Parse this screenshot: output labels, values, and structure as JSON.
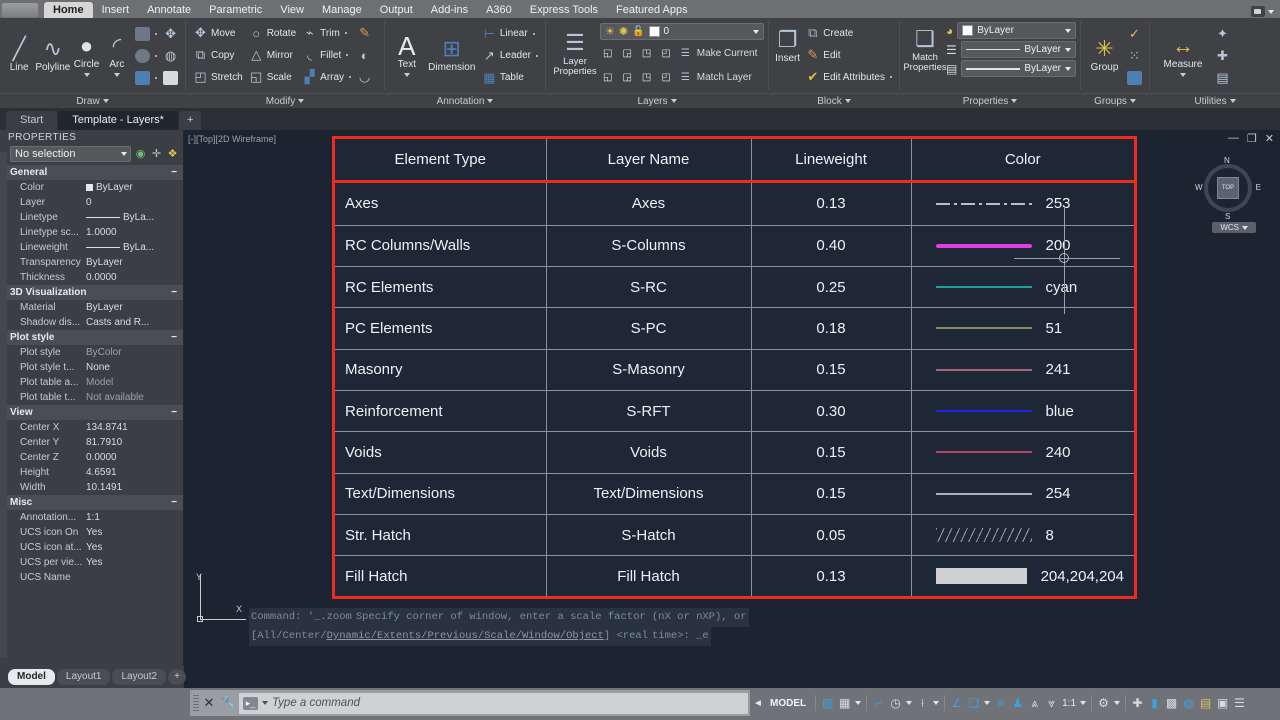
{
  "menubar": {
    "tabs": [
      {
        "label": "Home",
        "active": true
      },
      {
        "label": "Insert",
        "active": false
      },
      {
        "label": "Annotate",
        "active": false
      },
      {
        "label": "Parametric",
        "active": false
      },
      {
        "label": "View",
        "active": false
      },
      {
        "label": "Manage",
        "active": false
      },
      {
        "label": "Output",
        "active": false
      },
      {
        "label": "Add-ins",
        "active": false
      },
      {
        "label": "A360",
        "active": false
      },
      {
        "label": "Express Tools",
        "active": false
      },
      {
        "label": "Featured Apps",
        "active": false
      }
    ]
  },
  "ribbon": {
    "panels": [
      {
        "title": "Draw",
        "big": [
          {
            "label": "Line",
            "icon": "line-icon",
            "glyph": "╱"
          },
          {
            "label": "Polyline",
            "icon": "polyline-icon",
            "glyph": "∿"
          },
          {
            "label": "Circle",
            "icon": "circle-icon",
            "glyph": "●",
            "has_caret": true
          },
          {
            "label": "Arc",
            "icon": "arc-icon",
            "glyph": "◜",
            "has_caret": true
          }
        ],
        "small": [
          {
            "label": "",
            "icon": "rectangle-icon",
            "glyph": "▭"
          },
          {
            "label": "",
            "icon": "ellipse-icon",
            "glyph": "⬭"
          },
          {
            "label": "",
            "icon": "hatch-icon",
            "glyph": "░"
          }
        ]
      },
      {
        "title": "Modify",
        "rows": [
          [
            {
              "label": "Move",
              "icon": "move-icon",
              "glyph": "✥"
            },
            {
              "label": "Rotate",
              "icon": "rotate-icon",
              "glyph": "⟳"
            },
            {
              "label": "Trim",
              "icon": "trim-icon",
              "glyph": "✂"
            }
          ],
          [
            {
              "label": "Copy",
              "icon": "copy-icon",
              "glyph": "⧉"
            },
            {
              "label": "Mirror",
              "icon": "mirror-icon",
              "glyph": "△"
            },
            {
              "label": "Fillet",
              "icon": "fillet-icon",
              "glyph": "◟"
            }
          ],
          [
            {
              "label": "Stretch",
              "icon": "stretch-icon",
              "glyph": "◰"
            },
            {
              "label": "Scale",
              "icon": "scale-icon",
              "glyph": "◱"
            },
            {
              "label": "Array",
              "icon": "array-icon",
              "glyph": "⊞"
            }
          ]
        ]
      },
      {
        "title": "Annotation",
        "big": [
          {
            "label": "Text",
            "icon": "text-icon",
            "glyph": "A",
            "has_caret": true
          },
          {
            "label": "Dimension",
            "icon": "dimension-icon",
            "glyph": "↦"
          }
        ],
        "small": [
          {
            "label": "Linear",
            "icon": "linear-dimension-icon",
            "glyph": "⊢"
          },
          {
            "label": "Leader",
            "icon": "leader-icon",
            "glyph": "↗"
          },
          {
            "label": "Table",
            "icon": "table-icon",
            "glyph": "⊞"
          }
        ]
      },
      {
        "title": "Layers",
        "big": [
          {
            "label": "Layer\nProperties",
            "icon": "layer-properties-icon",
            "glyph": "☲"
          }
        ],
        "layer_combo": {
          "value": "0",
          "icons": [
            "lightbulb-icon",
            "sun-icon",
            "unlock-icon"
          ],
          "swatch": "#ffffff"
        },
        "small": [
          {
            "label": "Make Current",
            "icon": "make-current-icon",
            "glyph": "☲"
          },
          {
            "label": "Match Layer",
            "icon": "match-layer-icon",
            "glyph": "☲"
          }
        ]
      },
      {
        "title": "Block",
        "big": [
          {
            "label": "Insert",
            "icon": "insert-block-icon",
            "glyph": "❐"
          }
        ],
        "small": [
          {
            "label": "Create",
            "icon": "create-block-icon",
            "glyph": "⧉"
          },
          {
            "label": "Edit",
            "icon": "edit-block-icon",
            "glyph": "✎"
          },
          {
            "label": "Edit Attributes",
            "icon": "edit-attributes-icon",
            "glyph": "✔",
            "has_caret": true
          }
        ]
      },
      {
        "title": "Properties",
        "big": [
          {
            "label": "Match\nProperties",
            "icon": "match-properties-icon",
            "glyph": "✎"
          }
        ],
        "combos": [
          {
            "value": "ByLayer",
            "icon": "color-wheel-icon",
            "kind": "color"
          },
          {
            "value": "ByLayer",
            "icon": "linetype-icon",
            "kind": "line"
          },
          {
            "value": "ByLayer",
            "icon": "lineweight-icon",
            "kind": "line2"
          }
        ]
      },
      {
        "title": "Groups",
        "big": [
          {
            "label": "Group",
            "icon": "group-icon",
            "glyph": "✧"
          }
        ],
        "small": [
          {
            "label": "",
            "icon": "ungroup-icon",
            "glyph": "✓"
          },
          {
            "label": "",
            "icon": "group-edit-icon",
            "glyph": "⁙"
          },
          {
            "label": "",
            "icon": "group-selection-icon",
            "glyph": "❖"
          }
        ]
      },
      {
        "title": "Utilities",
        "big": [
          {
            "label": "Measure",
            "icon": "measure-icon",
            "glyph": "↔",
            "has_caret": true
          }
        ],
        "small": [
          {
            "label": "",
            "icon": "quick-select-icon",
            "glyph": "✦"
          },
          {
            "label": "",
            "icon": "point-icon",
            "glyph": "✚"
          },
          {
            "label": "",
            "icon": "calculator-icon",
            "glyph": "▤"
          }
        ]
      }
    ]
  },
  "filetabs": [
    {
      "label": "Start",
      "active": false
    },
    {
      "label": "Template - Layers*",
      "active": true
    },
    {
      "label": "+",
      "active": false
    }
  ],
  "properties": {
    "title": "PROPERTIES",
    "selection": "No selection",
    "toolbar_icons": [
      "quick-select-icon",
      "pick-add-icon",
      "select-similar-icon"
    ],
    "groups": [
      {
        "name": "General",
        "rows": [
          {
            "key": "Color",
            "value": "ByLayer",
            "kind": "swatch"
          },
          {
            "key": "Layer",
            "value": "0"
          },
          {
            "key": "Linetype",
            "value": "ByLa...",
            "kind": "line"
          },
          {
            "key": "Linetype sc...",
            "value": "1.0000"
          },
          {
            "key": "Lineweight",
            "value": "ByLa...",
            "kind": "line"
          },
          {
            "key": "Transparency",
            "value": "ByLayer"
          },
          {
            "key": "Thickness",
            "value": "0.0000"
          }
        ]
      },
      {
        "name": "3D Visualization",
        "rows": [
          {
            "key": "Material",
            "value": "ByLayer"
          },
          {
            "key": "Shadow dis...",
            "value": "Casts and R..."
          }
        ]
      },
      {
        "name": "Plot style",
        "rows": [
          {
            "key": "Plot style",
            "value": "ByColor",
            "dim": true
          },
          {
            "key": "Plot style t...",
            "value": "None"
          },
          {
            "key": "Plot table a...",
            "value": "Model",
            "dim": true
          },
          {
            "key": "Plot table t...",
            "value": "Not available",
            "dim": true
          }
        ]
      },
      {
        "name": "View",
        "rows": [
          {
            "key": "Center X",
            "value": "134.8741"
          },
          {
            "key": "Center Y",
            "value": "81.7910"
          },
          {
            "key": "Center Z",
            "value": "0.0000"
          },
          {
            "key": "Height",
            "value": "4.6591"
          },
          {
            "key": "Width",
            "value": "10.1491"
          }
        ]
      },
      {
        "name": "Misc",
        "rows": [
          {
            "key": "Annotation...",
            "value": "1:1"
          },
          {
            "key": "UCS icon On",
            "value": "Yes"
          },
          {
            "key": "UCS icon at...",
            "value": "Yes"
          },
          {
            "key": "UCS per vie...",
            "value": "Yes"
          },
          {
            "key": "UCS Name",
            "value": ""
          }
        ]
      }
    ]
  },
  "canvas": {
    "viewport_label": "[-][Top][2D Wireframe]",
    "window_controls": [
      "minimize-icon",
      "restore-icon",
      "close-icon"
    ],
    "viewcube": {
      "top": "TOP",
      "n": "N",
      "s": "S",
      "w": "W",
      "e": "E",
      "wcs": "WCS"
    },
    "ucs": {
      "x": "X",
      "y": "Y"
    },
    "command_history": [
      "Command: '_.zoom",
      "Specify corner of window, enter a scale factor (nX or nXP), or",
      "[All/Center/Dynamic/Extents/Previous/Scale/Window/Object] <real",
      "time>: _e"
    ]
  },
  "table": {
    "border_color": "#ef2a21",
    "headers": [
      "Element Type",
      "Layer Name",
      "Lineweight",
      "Color"
    ],
    "rows": [
      {
        "element": "Axes",
        "layer": "Axes",
        "lineweight": "0.13",
        "color_value": "253",
        "line_style": "dashdot",
        "line_color": "#b9bfc7"
      },
      {
        "element": "RC Columns/Walls",
        "layer": "S-Columns",
        "lineweight": "0.40",
        "color_value": "200",
        "line_style": "thick",
        "line_color": "#e23ce2"
      },
      {
        "element": "RC Elements",
        "layer": "S-RC",
        "lineweight": "0.25",
        "color_value": "cyan",
        "line_style": "solid",
        "line_color": "#1f9d9d"
      },
      {
        "element": "PC Elements",
        "layer": "S-PC",
        "lineweight": "0.18",
        "color_value": "51",
        "line_style": "solid",
        "line_color": "#8d8a63"
      },
      {
        "element": "Masonry",
        "layer": "S-Masonry",
        "lineweight": "0.15",
        "color_value": "241",
        "line_style": "solid",
        "line_color": "#a06878"
      },
      {
        "element": "Reinforcement",
        "layer": "S-RFT",
        "lineweight": "0.30",
        "color_value": "blue",
        "line_style": "solid",
        "line_color": "#2222ef"
      },
      {
        "element": "Voids",
        "layer": "Voids",
        "lineweight": "0.15",
        "color_value": "240",
        "line_style": "solid",
        "line_color": "#b0485f"
      },
      {
        "element": "Text/Dimensions",
        "layer": "Text/Dimensions",
        "lineweight": "0.15",
        "color_value": "254",
        "line_style": "solid",
        "line_color": "#a9afb8"
      },
      {
        "element": "Str. Hatch",
        "layer": "S-Hatch",
        "lineweight": "0.05",
        "color_value": "8",
        "line_style": "hatch",
        "line_color": "#9aa1ab"
      },
      {
        "element": "Fill Hatch",
        "layer": "Fill Hatch",
        "lineweight": "0.13",
        "color_value": "204,204,204",
        "line_style": "swatch",
        "line_color": "#cfcfcf"
      }
    ]
  },
  "layout_tabs": [
    {
      "label": "Model",
      "active": true
    },
    {
      "label": "Layout1",
      "active": false
    },
    {
      "label": "Layout2",
      "active": false
    },
    {
      "label": "+",
      "active": false
    }
  ],
  "command_line": {
    "placeholder": "Type a command",
    "close_icon": "close-icon",
    "settings_icon": "wrench-icon",
    "prompt_icon": "prompt-icon"
  },
  "status_bar": {
    "space_label": "MODEL",
    "scale": "1:1",
    "icons": [
      "grid-display-icon",
      "snap-mode-icon",
      "snap-dropdown-icon",
      "ortho-mode-icon",
      "polar-tracking-icon",
      "polar-dropdown-icon",
      "object-snap-icon",
      "osnap-dropdown-icon",
      "3d-object-snap-icon",
      "object-snap-tracking-icon",
      "annotation-visibility-icon",
      "autoscale-icon",
      "annotation-scale-icon",
      "workspace-icon",
      "workspace-dropdown-icon",
      "isolate-objects-icon",
      "hardware-accel-icon",
      "isolate-icon",
      "clean-screen-icon",
      "customization-icon"
    ]
  }
}
